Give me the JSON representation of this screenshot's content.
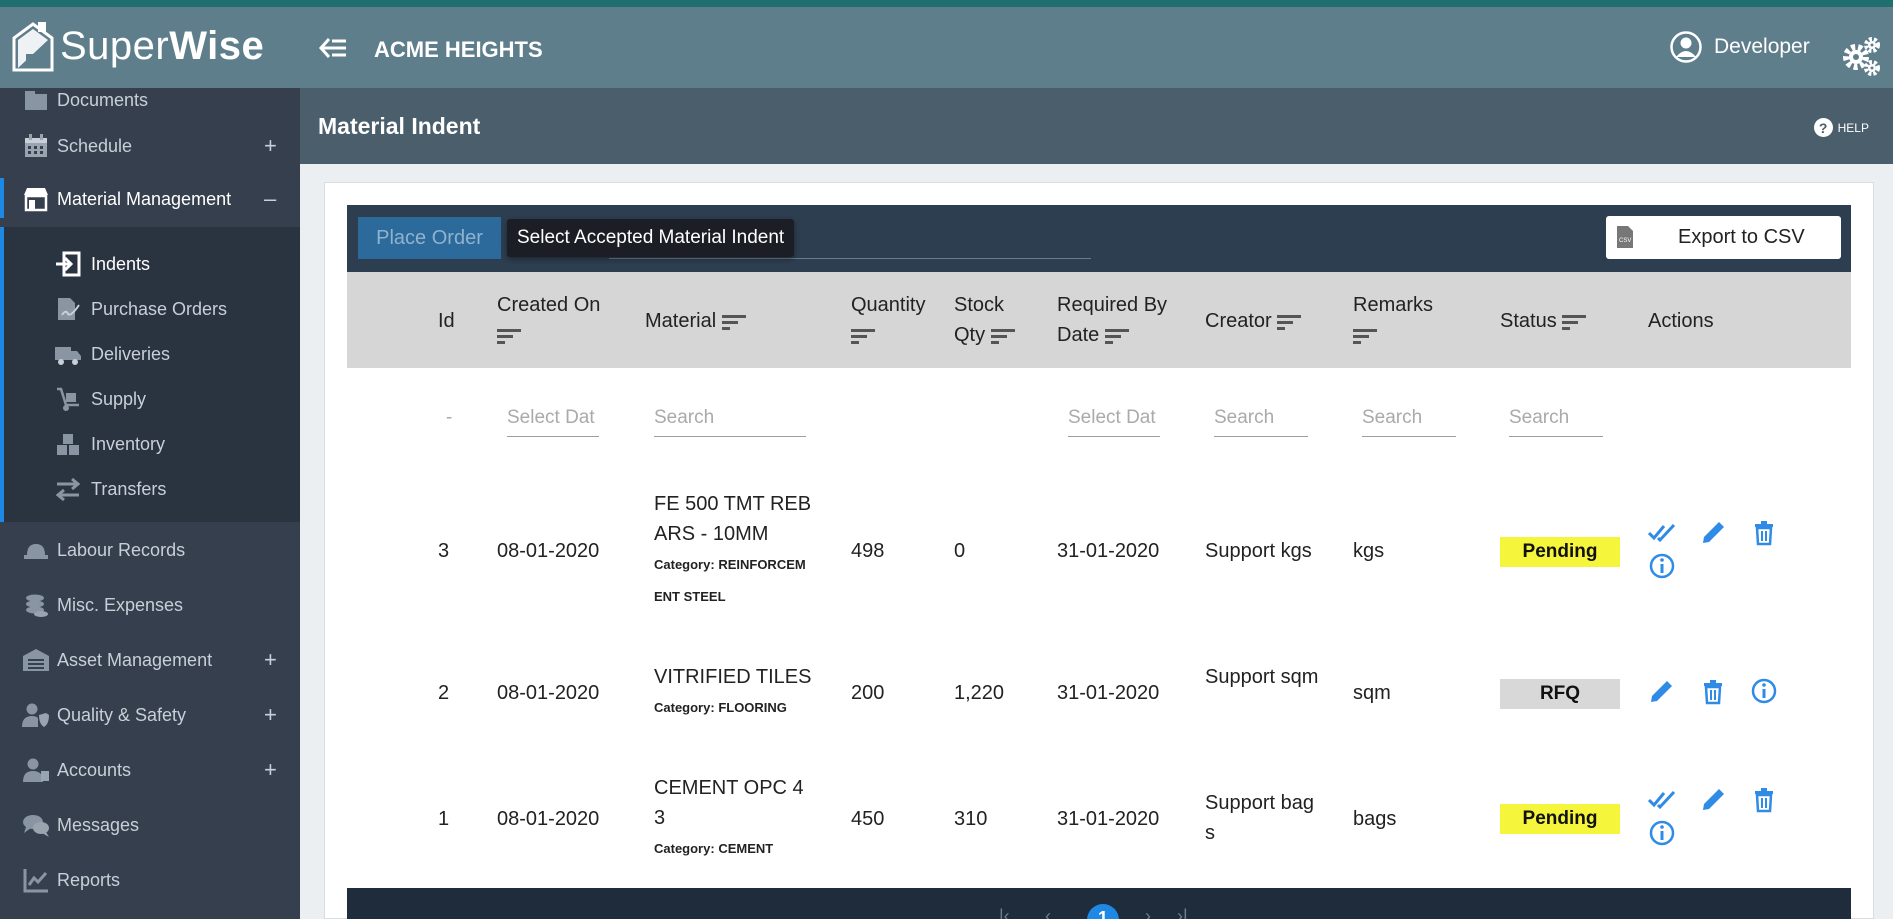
{
  "app": {
    "logo_plain": "Super",
    "logo_bold": "Wise",
    "site_name": "ACME HEIGHTS",
    "user_name": "Developer"
  },
  "sidebar": {
    "items": [
      {
        "label": "Documents",
        "icon": "folder-icon"
      },
      {
        "label": "Schedule",
        "icon": "calendar-icon",
        "toggle": "+"
      },
      {
        "label": "Material Management",
        "icon": "store-icon",
        "toggle": "–"
      },
      {
        "label": "Labour Records",
        "icon": "hard-hat-icon"
      },
      {
        "label": "Misc. Expenses",
        "icon": "coins-icon"
      },
      {
        "label": "Asset Management",
        "icon": "warehouse-icon",
        "toggle": "+"
      },
      {
        "label": "Quality & Safety",
        "icon": "user-shield-icon",
        "toggle": "+"
      },
      {
        "label": "Accounts",
        "icon": "accounts-icon",
        "toggle": "+"
      },
      {
        "label": "Messages",
        "icon": "chat-icon"
      },
      {
        "label": "Reports",
        "icon": "chart-line-icon"
      }
    ],
    "sub_items": [
      {
        "label": "Indents",
        "icon": "sign-in-icon"
      },
      {
        "label": "Purchase Orders",
        "icon": "file-signature-icon"
      },
      {
        "label": "Deliveries",
        "icon": "truck-icon"
      },
      {
        "label": "Supply",
        "icon": "dolly-icon"
      },
      {
        "label": "Inventory",
        "icon": "boxes-icon"
      },
      {
        "label": "Transfers",
        "icon": "exchange-icon"
      }
    ]
  },
  "page": {
    "title": "Material Indent",
    "help": "HELP"
  },
  "toolbar": {
    "place_order": "Place Order",
    "tooltip": "Select Accepted Material Indent",
    "export": "Export to CSV"
  },
  "table": {
    "headers": {
      "id": "Id",
      "created_on": "Created On",
      "material": "Material",
      "quantity": "Quantity",
      "stock_qty": "Stock Qty",
      "required_by": "Required By Date",
      "creator": "Creator",
      "remarks": "Remarks",
      "status": "Status",
      "actions": "Actions"
    },
    "filters": {
      "date_placeholder": "Select Dat",
      "search_placeholder": "Search",
      "id_placeholder": "-"
    },
    "rows": [
      {
        "id": "3",
        "created_on": "08-01-2020",
        "material": "FE 500 TMT REBARS - 10MM",
        "category_label": "Category:",
        "category": "REINFORCEMENT STEEL",
        "quantity": "498",
        "stock_qty": "0",
        "required_by": "31-01-2020",
        "creator": "Support kgs",
        "remarks": "kgs",
        "status": "Pending"
      },
      {
        "id": "2",
        "created_on": "08-01-2020",
        "material": "VITRIFIED TILES",
        "category_label": "Category:",
        "category": "FLOORING",
        "quantity": "200",
        "stock_qty": "1,220",
        "required_by": "31-01-2020",
        "creator": "Support sqm",
        "remarks": "sqm",
        "status": "RFQ"
      },
      {
        "id": "1",
        "created_on": "08-01-2020",
        "material": "CEMENT OPC 43",
        "category_label": "Category:",
        "category": "CEMENT",
        "quantity": "450",
        "stock_qty": "310",
        "required_by": "31-01-2020",
        "creator": "Support bags",
        "remarks": "bags",
        "status": "Pending"
      }
    ]
  },
  "pagination": {
    "current_page": "1"
  },
  "colors": {
    "accent": "#1e88e5",
    "pending": "#f5f53b",
    "rfq": "#d8d8d8",
    "topbar": "#5f7e8b",
    "sidebar": "#353f4e"
  }
}
